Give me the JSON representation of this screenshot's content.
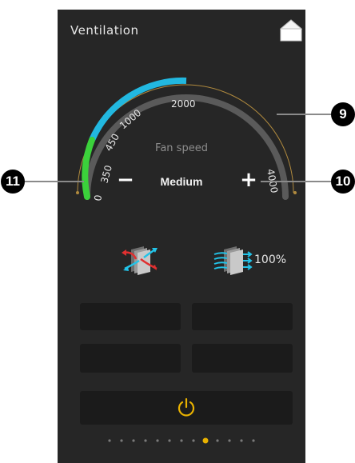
{
  "header": {
    "title": "Ventilation",
    "home_icon": "home-icon"
  },
  "gauge": {
    "label": "Fan speed",
    "mode": "Medium",
    "scale_labels": [
      "0",
      "350",
      "450",
      "1000",
      "2000",
      "4000"
    ],
    "minus_label": "−",
    "plus_label": "+",
    "level_fraction": 0.5,
    "colors": {
      "track": "#5a5a5a",
      "green": "#3bd13b",
      "cyan": "#22b8e0",
      "outline": "#b08a3e"
    }
  },
  "status": {
    "heat_exchanger_icon": "heat-exchanger-icon",
    "filter_icon": "filter-icon",
    "filter_value": "100%"
  },
  "power": {
    "icon": "power-icon",
    "color": "#e8b100"
  },
  "pager": {
    "count": 13,
    "active_index": 8,
    "active_color": "#e8b100"
  },
  "callouts": {
    "fan_speed_scale": "9",
    "increase": "10",
    "decrease": "11"
  }
}
